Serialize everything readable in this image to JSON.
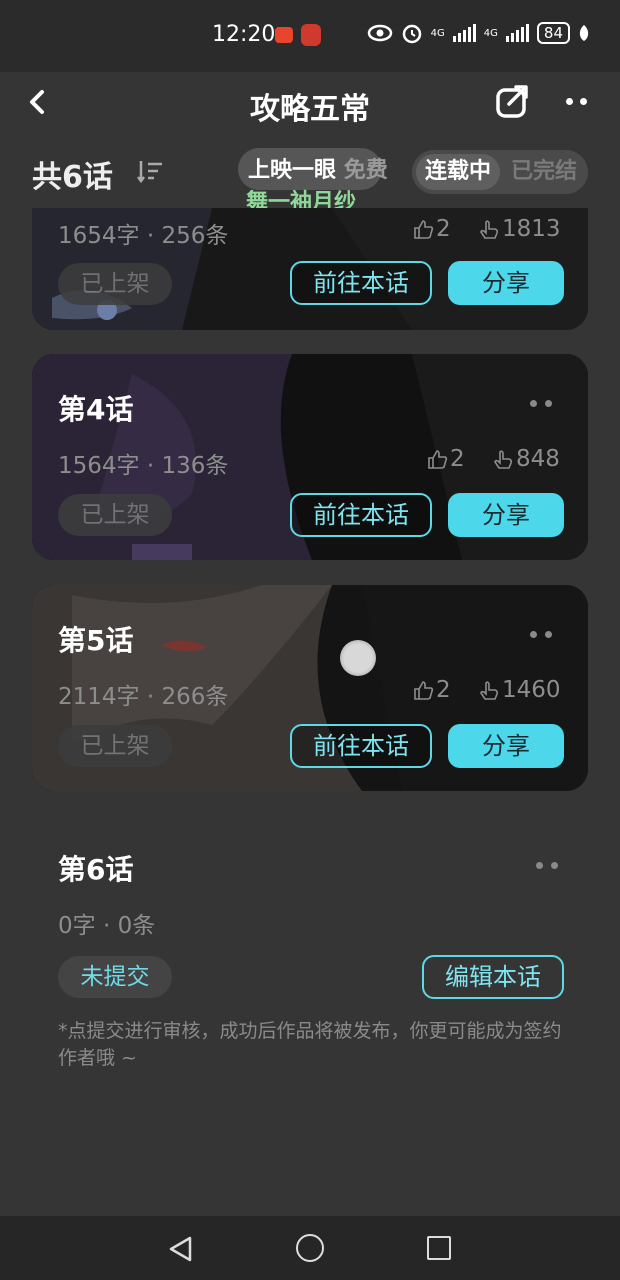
{
  "status_bar": {
    "time": "12:20",
    "network_1": "4G",
    "network_2": "4G",
    "battery": "84"
  },
  "header": {
    "title": "攻略五￼￼常",
    "back_icon": "chevron-left-icon",
    "share_icon": "share-icon",
    "more_icon": "more-dots-icon"
  },
  "filter": {
    "count_label": "共6话",
    "sort_icon": "sort-icon",
    "status_active": "连载中",
    "status_inactive": "已完结"
  },
  "overlay": {
    "line1_bright": "上映",
    "line1_mid": "一眼",
    "line1_dim": "免费",
    "line2": "舞一袖月纱"
  },
  "chapters": [
    {
      "title": "",
      "stats": "1654字 · 256条",
      "likes": "2",
      "views": "1813",
      "status": "已上架",
      "goto_label": "前往本话",
      "share_label": "分享"
    },
    {
      "title": "第4话",
      "stats": "1564字 · 136条",
      "likes": "2",
      "views": "848",
      "status": "已上架",
      "goto_label": "前往本话",
      "share_label": "分享"
    },
    {
      "title": "第5话",
      "stats": "2114字 · 266条",
      "likes": "2",
      "views": "1460",
      "status": "已上架",
      "goto_label": "前往本话",
      "share_label": "分享"
    },
    {
      "title": "第6话",
      "stats": "0字 · 0条",
      "status": "未提交",
      "edit_label": "编辑本话",
      "note": "*点提交进行审核，成功后作品将被发布，你更可能成为签约作者哦 ~"
    }
  ],
  "colors": {
    "accent": "#4cd8ea",
    "background": "#353535"
  }
}
